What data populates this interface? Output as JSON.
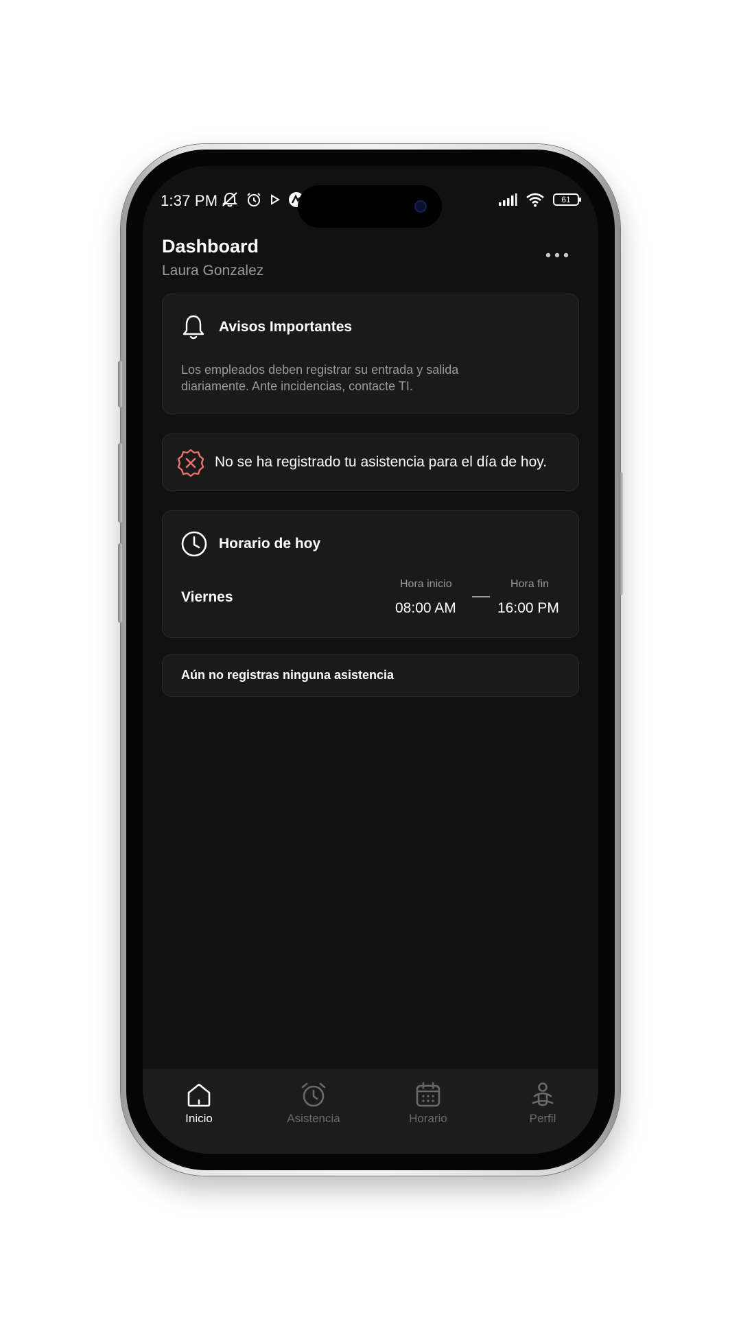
{
  "status_bar": {
    "time": "1:37 PM",
    "battery": "61"
  },
  "header": {
    "title": "Dashboard",
    "subtitle": "Laura Gonzalez"
  },
  "notice": {
    "title": "Avisos Importantes",
    "text": "Los empleados deben registrar su entrada y salida diariamente. Ante incidencias, contacte TI."
  },
  "alert": {
    "text": "No se ha registrado tu asistencia para el día de hoy.",
    "color": "#f0716b"
  },
  "schedule": {
    "title": "Horario de hoy",
    "day": "Viernes",
    "start_label": "Hora inicio",
    "start_time": "08:00 AM",
    "end_label": "Hora fin",
    "end_time": "16:00 PM"
  },
  "attendance": {
    "empty_text": "Aún no registras ninguna asistencia"
  },
  "bottom_nav": {
    "items": [
      {
        "label": "Inicio",
        "icon": "home-icon",
        "active": true
      },
      {
        "label": "Asistencia",
        "icon": "alarm-clock-icon",
        "active": false
      },
      {
        "label": "Horario",
        "icon": "calendar-icon",
        "active": false
      },
      {
        "label": "Perfil",
        "icon": "person-icon",
        "active": false
      }
    ],
    "active_color": "#ffffff",
    "inactive_color": "#6a6a6a"
  }
}
